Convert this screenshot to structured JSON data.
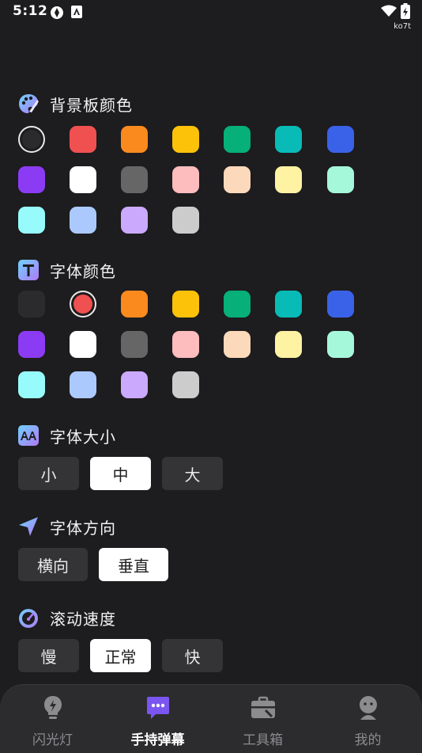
{
  "status_bar": {
    "time": "5:12",
    "carrier": "ko7t"
  },
  "background_color": {
    "title": "背景板颜色",
    "icon": "palette-icon",
    "rows": [
      [
        "#2b2b2d",
        "#f15050",
        "#fb8a1e",
        "#fcc20a",
        "#06b078",
        "#08bbb7",
        "#3a62e8"
      ],
      [
        "#8c3bf5",
        "#ffffff",
        "#666666",
        "#fdbcbe",
        "#fdd9bc",
        "#fef2a3",
        "#a6f8da"
      ],
      [
        "#97fbfc",
        "#acc9fe",
        "#cba9fd",
        "#cccccc"
      ]
    ],
    "selected": "#2b2b2d"
  },
  "font_color": {
    "title": "字体颜色",
    "icon": "text-t-icon",
    "rows": [
      [
        "#2b2b2d",
        "#f15050",
        "#fb8a1e",
        "#fcc20a",
        "#06b078",
        "#08bbb7",
        "#3a62e8"
      ],
      [
        "#8c3bf5",
        "#ffffff",
        "#666666",
        "#fdbcbe",
        "#fdd9bc",
        "#fef2a3",
        "#a6f8da"
      ],
      [
        "#97fbfc",
        "#acc9fe",
        "#cba9fd",
        "#cccccc"
      ]
    ],
    "selected": "#f15050"
  },
  "font_size": {
    "title": "字体大小",
    "icon": "font-size-aa-icon",
    "options": [
      "小",
      "中",
      "大"
    ],
    "selected": "中"
  },
  "font_direction": {
    "title": "字体方向",
    "icon": "navigation-arrow-icon",
    "options": [
      "横向",
      "垂直"
    ],
    "selected": "垂直"
  },
  "scroll_speed": {
    "title": "滚动速度",
    "icon": "speedometer-icon",
    "options": [
      "慢",
      "正常",
      "快"
    ],
    "selected": "正常"
  },
  "tabs": [
    {
      "label": "闪光灯",
      "icon": "lightbulb-icon"
    },
    {
      "label": "手持弹幕",
      "icon": "chat-bubble-icon"
    },
    {
      "label": "工具箱",
      "icon": "toolbox-icon"
    },
    {
      "label": "我的",
      "icon": "user-icon"
    }
  ],
  "active_tab": "手持弹幕",
  "colors": {
    "background": "#1d1c1e",
    "button": "#343335",
    "tab_bar": "#2c2b2e",
    "accent": "#7a55f0"
  }
}
